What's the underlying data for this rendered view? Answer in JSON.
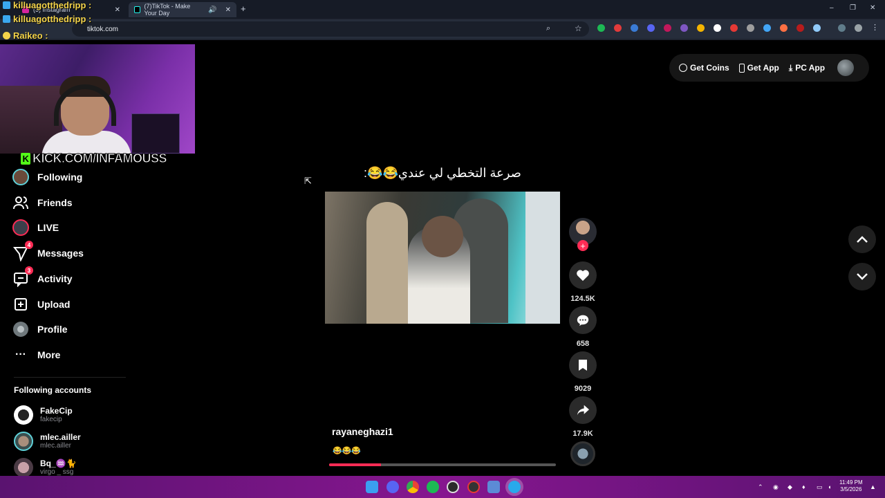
{
  "browser": {
    "tabs": [
      {
        "title": "(3) Instagram",
        "favicon_color": "#d6249f"
      },
      {
        "title": "(7)TikTok - Make Your Day",
        "favicon_color": "#000000"
      }
    ],
    "new_tab": "+",
    "url": "tiktok.com",
    "window_controls": [
      "–",
      "❐",
      "✕"
    ]
  },
  "chat_overlay": [
    {
      "user": "killuagotthedripp :",
      "icon_color": "#3aa8f0"
    },
    {
      "user": "killuagotthedripp :",
      "icon_color": "#3aa8f0"
    },
    {
      "user": "Raikeo :",
      "icon_color": "#f3d34a"
    }
  ],
  "stream": {
    "kick_logo_letter": "K",
    "kick_url": "KICK.COM/INFAMOUSS"
  },
  "sidebar": {
    "items": [
      {
        "label": "Following",
        "icon": "following-avatar-icon",
        "badge": ""
      },
      {
        "label": "Friends",
        "icon": "friends-icon",
        "badge": ""
      },
      {
        "label": "LIVE",
        "icon": "live-avatar-icon",
        "badge": ""
      },
      {
        "label": "Messages",
        "icon": "messages-icon",
        "badge": "4"
      },
      {
        "label": "Activity",
        "icon": "activity-icon",
        "badge": "3"
      },
      {
        "label": "Upload",
        "icon": "upload-icon",
        "badge": ""
      },
      {
        "label": "Profile",
        "icon": "profile-avatar-icon",
        "badge": ""
      },
      {
        "label": "More",
        "icon": "more-icon",
        "badge": ""
      }
    ],
    "following_header": "Following accounts",
    "accounts": [
      {
        "name": "FakeCip",
        "username": "fakecip"
      },
      {
        "name": "mlec.ailler",
        "username": "mlec.ailler"
      },
      {
        "name": "Bq_♒🐈",
        "username": "virgo _ ssg"
      }
    ]
  },
  "topbar": {
    "get_coins": "Get Coins",
    "get_app": "Get App",
    "pc_app": "PC App"
  },
  "video": {
    "caption": "صرعة التخطي لي عندي😂😂:",
    "author": "rayaneghazi1",
    "description": "😂😂😂",
    "progress": 0.23
  },
  "actions": {
    "likes": "124.5K",
    "comments": "658",
    "saves": "9029",
    "shares": "17.9K"
  },
  "taskbar": {
    "time": "11:49 PM",
    "date": "3/5/2026"
  }
}
